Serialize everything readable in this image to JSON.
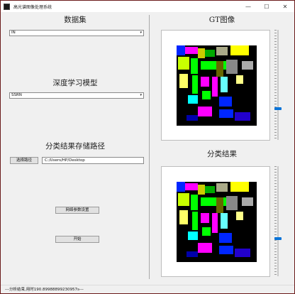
{
  "titlebar": {
    "title": "高光谱图像处理系统",
    "icons": {
      "app": "app-icon",
      "minimize": "minimize-icon",
      "maximize": "maximize-icon",
      "close": "close-icon"
    },
    "glyphs": {
      "minimize": "—",
      "maximize": "☐",
      "close": "✕"
    }
  },
  "left": {
    "dataset_heading": "数据集",
    "dataset_value": "IN",
    "model_heading": "深度学习模型",
    "model_value": "SSRN",
    "path_heading": "分类结果存储路径",
    "choose_path_label": "选择路径",
    "path_value": "C:/Users/HP/Desktop",
    "network_settings_label": "网络参数设置",
    "start_label": "开始",
    "combo_arrow": "▾"
  },
  "right": {
    "gt_heading": "GT图像",
    "result_heading": "分类结果",
    "gt_slider_level": 0.72,
    "result_slider_level": 0.66
  },
  "colors": {
    "background": "#000000",
    "slider_handle": "#0a74d8",
    "window_border": "#6b1a1a"
  },
  "status": {
    "text": "---分析结束,用时190.89988899230957s---"
  }
}
